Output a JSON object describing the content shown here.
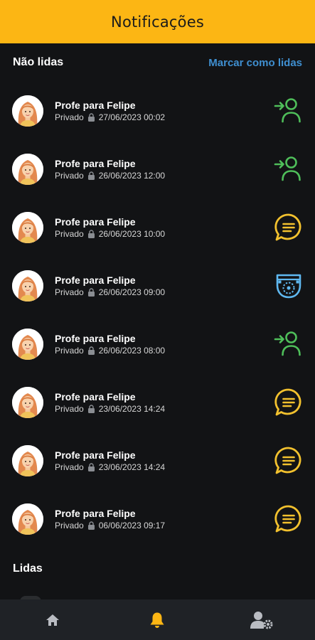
{
  "header": {
    "title": "Notificações"
  },
  "unread": {
    "title": "Não lidas",
    "mark_all_label": "Marcar como lidas",
    "items": [
      {
        "sender": "Profe para Felipe",
        "visibility": "Privado",
        "datetime": "27/06/2023 00:02",
        "type": "check-in-icon"
      },
      {
        "sender": "Profe para Felipe",
        "visibility": "Privado",
        "datetime": "26/06/2023 12:00",
        "type": "check-in-icon"
      },
      {
        "sender": "Profe para Felipe",
        "visibility": "Privado",
        "datetime": "26/06/2023 10:00",
        "type": "message-icon"
      },
      {
        "sender": "Profe para Felipe",
        "visibility": "Privado",
        "datetime": "26/06/2023 09:00",
        "type": "diaper-icon"
      },
      {
        "sender": "Profe para Felipe",
        "visibility": "Privado",
        "datetime": "26/06/2023 08:00",
        "type": "check-in-icon"
      },
      {
        "sender": "Profe para Felipe",
        "visibility": "Privado",
        "datetime": "23/06/2023 14:24",
        "type": "message-icon"
      },
      {
        "sender": "Profe para Felipe",
        "visibility": "Privado",
        "datetime": "23/06/2023 14:24",
        "type": "message-icon"
      },
      {
        "sender": "Profe para Felipe",
        "visibility": "Privado",
        "datetime": "06/06/2023 09:17",
        "type": "message-icon"
      }
    ]
  },
  "read": {
    "title": "Lidas"
  },
  "nav": [
    {
      "icon": "home-icon",
      "active": false
    },
    {
      "icon": "bell-icon",
      "active": true
    },
    {
      "icon": "user-settings-icon",
      "active": false
    }
  ],
  "colors": {
    "header": "#fcb614",
    "background": "#121315",
    "link": "#3f8fd0",
    "check_in": "#4fbf5a",
    "message": "#f2c12e",
    "diaper": "#5fb8f0",
    "nav_active": "#fcb614",
    "nav_inactive": "#b9bcc2"
  }
}
